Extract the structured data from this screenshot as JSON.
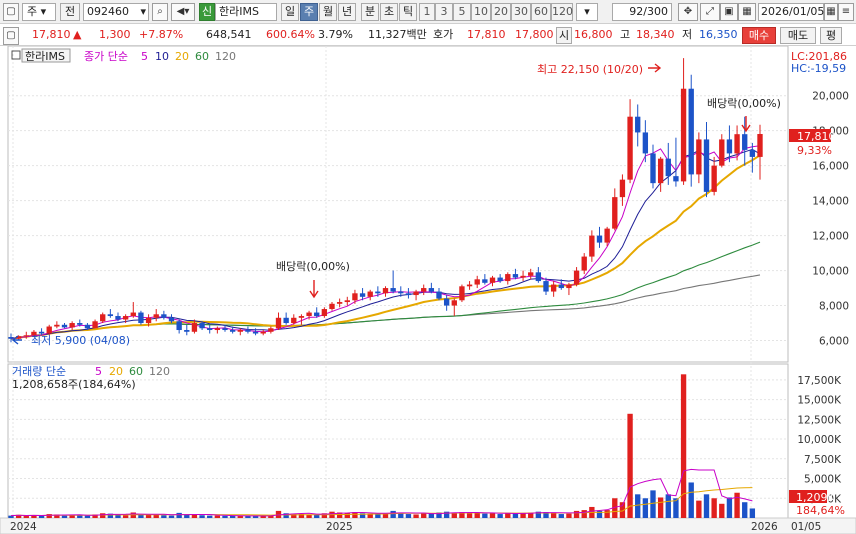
{
  "toolbar": {
    "market": "주",
    "mode": "전",
    "code": "092460",
    "badge": "신",
    "name": "한라IMS",
    "periods": [
      "일",
      "주",
      "월",
      "년",
      "분",
      "초",
      "틱"
    ],
    "selected_period": "주",
    "numbers": [
      "1",
      "3",
      "5",
      "10",
      "20",
      "30",
      "60",
      "120"
    ],
    "count": "92/300",
    "date": "2026/01/05"
  },
  "quote": {
    "price": "17,810",
    "arrow": "▲",
    "change": "1,300",
    "change_pct": "+7.87%",
    "volume": "648,541",
    "vol_ratio": "600.64%",
    "turnover": "3.79%",
    "amount": "11,327백만",
    "hoga_label": "호가",
    "ask": "17,810",
    "bid": "17,800",
    "open_label": "시",
    "open": "16,800",
    "high_label": "고",
    "high": "18,340",
    "low_label": "저",
    "low": "16,350",
    "buy": "매수",
    "sell": "매도",
    "eval": "평"
  },
  "price_legend": {
    "title": "한라IMS",
    "items": [
      "종가 단순",
      "5",
      "10",
      "20",
      "60",
      "120"
    ]
  },
  "volume_legend": {
    "items": [
      "거래량 단순",
      "5",
      "20",
      "60",
      "120"
    ],
    "last": "1,208,658주(184,64%)"
  },
  "annotations": {
    "lc": "LC:201,86",
    "hc": "HC:-19,59",
    "high": "최고 22,150 (10/20)",
    "low": "최저 5,900 (04/08)",
    "div1": "배당락(0,00%)",
    "div2": "배당락(0,00%)",
    "price_tag": "17,810",
    "price_pct": "9,33%",
    "vol_tag": "1,209K",
    "vol_pct": "184,64%"
  },
  "colors": {
    "up": "#e0201e",
    "down": "#1c53c8",
    "ma5": "#c800c8",
    "ma10": "#1e1e96",
    "ma20": "#e6a800",
    "ma60": "#2e8b3e",
    "ma120": "#777777"
  },
  "chart_data": {
    "type": "candlestick",
    "price_axis": {
      "min": 5000,
      "max": 22500,
      "ticks": [
        6000,
        8000,
        10000,
        12000,
        14000,
        16000,
        18000,
        20000
      ]
    },
    "volume_axis": {
      "min": 0,
      "max": 19000,
      "ticks": [
        2500,
        5000,
        7500,
        10000,
        12500,
        15000,
        17500
      ],
      "labels": [
        "2,500K",
        "5,000K",
        "7,500K",
        "10,000K",
        "12,500K",
        "15,000K",
        "17,500K"
      ]
    },
    "price_tick_labels": [
      "6,000",
      "8,000",
      "10,000",
      "12,000",
      "14,000",
      "16,000",
      "18,000",
      "20,000"
    ],
    "x_labels": [
      "2024",
      "2025",
      "2026",
      "01/05"
    ],
    "ohlc": [
      [
        6200,
        6400,
        5900,
        6100
      ],
      [
        6100,
        6300,
        6000,
        6250
      ],
      [
        6250,
        6500,
        6100,
        6300
      ],
      [
        6300,
        6600,
        6200,
        6500
      ],
      [
        6500,
        6700,
        6300,
        6400
      ],
      [
        6400,
        6900,
        6300,
        6800
      ],
      [
        6800,
        7100,
        6700,
        6900
      ],
      [
        6900,
        7000,
        6700,
        6750
      ],
      [
        6750,
        7100,
        6600,
        7000
      ],
      [
        7000,
        7200,
        6800,
        6900
      ],
      [
        6900,
        7000,
        6600,
        6700
      ],
      [
        6700,
        7200,
        6700,
        7100
      ],
      [
        7100,
        7600,
        7000,
        7500
      ],
      [
        7500,
        7800,
        7300,
        7400
      ],
      [
        7400,
        7600,
        7100,
        7200
      ],
      [
        7200,
        7500,
        7000,
        7400
      ],
      [
        7400,
        8200,
        7300,
        7600
      ],
      [
        7600,
        7700,
        6900,
        7000
      ],
      [
        7000,
        7500,
        6800,
        7300
      ],
      [
        7300,
        7800,
        7100,
        7500
      ],
      [
        7500,
        7700,
        7200,
        7300
      ],
      [
        7300,
        7500,
        7000,
        7100
      ],
      [
        7100,
        7200,
        6400,
        6600
      ],
      [
        6600,
        6900,
        6300,
        6500
      ],
      [
        6500,
        7200,
        6400,
        7000
      ],
      [
        7000,
        7100,
        6600,
        6700
      ],
      [
        6700,
        6900,
        6400,
        6600
      ],
      [
        6600,
        6800,
        6400,
        6700
      ],
      [
        6700,
        6900,
        6500,
        6600
      ],
      [
        6600,
        6800,
        6400,
        6500
      ],
      [
        6500,
        6700,
        6300,
        6600
      ],
      [
        6600,
        6800,
        6400,
        6500
      ],
      [
        6500,
        6700,
        6300,
        6400
      ],
      [
        6400,
        6600,
        6300,
        6500
      ],
      [
        6500,
        6800,
        6400,
        6700
      ],
      [
        6700,
        7600,
        6600,
        7300
      ],
      [
        7300,
        7600,
        6900,
        7000
      ],
      [
        7000,
        7500,
        6900,
        7300
      ],
      [
        7300,
        7500,
        6900,
        7400
      ],
      [
        7400,
        7700,
        7200,
        7600
      ],
      [
        7600,
        7900,
        7300,
        7400
      ],
      [
        7400,
        7900,
        7300,
        7800
      ],
      [
        7800,
        8200,
        7700,
        8100
      ],
      [
        8100,
        8400,
        7900,
        8200
      ],
      [
        8200,
        8500,
        8000,
        8300
      ],
      [
        8300,
        8900,
        8100,
        8700
      ],
      [
        8700,
        9000,
        8300,
        8500
      ],
      [
        8500,
        8900,
        8300,
        8800
      ],
      [
        8800,
        9100,
        8500,
        8700
      ],
      [
        8700,
        9100,
        8500,
        9000
      ],
      [
        9000,
        10000,
        8700,
        8800
      ],
      [
        8800,
        9100,
        8500,
        8700
      ],
      [
        8700,
        9000,
        8400,
        8600
      ],
      [
        8600,
        8900,
        8300,
        8800
      ],
      [
        8800,
        9200,
        8600,
        9000
      ],
      [
        9000,
        9300,
        8700,
        8800
      ],
      [
        8800,
        9000,
        8300,
        8400
      ],
      [
        8400,
        8600,
        7700,
        8000
      ],
      [
        8000,
        8400,
        7400,
        8300
      ],
      [
        8300,
        9200,
        8200,
        9100
      ],
      [
        9100,
        9400,
        8900,
        9200
      ],
      [
        9200,
        9700,
        9000,
        9500
      ],
      [
        9500,
        9800,
        9200,
        9300
      ],
      [
        9300,
        9700,
        9100,
        9600
      ],
      [
        9600,
        9800,
        9300,
        9400
      ],
      [
        9400,
        9900,
        9200,
        9800
      ],
      [
        9800,
        10100,
        9500,
        9600
      ],
      [
        9600,
        10000,
        9400,
        9700
      ],
      [
        9700,
        10100,
        9500,
        9900
      ],
      [
        9900,
        10200,
        9300,
        9400
      ],
      [
        9400,
        9600,
        8600,
        8800
      ],
      [
        8800,
        9400,
        8500,
        9200
      ],
      [
        9200,
        9500,
        8900,
        9000
      ],
      [
        9000,
        9300,
        8600,
        9200
      ],
      [
        9200,
        10200,
        9100,
        10000
      ],
      [
        10000,
        11000,
        9800,
        10800
      ],
      [
        10800,
        12300,
        10500,
        12000
      ],
      [
        12000,
        12500,
        11300,
        11600
      ],
      [
        11600,
        12500,
        11400,
        12400
      ],
      [
        12400,
        14700,
        12300,
        14200
      ],
      [
        14200,
        15500,
        13700,
        15200
      ],
      [
        15200,
        19800,
        15000,
        18800
      ],
      [
        18800,
        19500,
        17100,
        17900
      ],
      [
        17900,
        18600,
        16200,
        16700
      ],
      [
        16700,
        17200,
        14700,
        15000
      ],
      [
        15000,
        16500,
        14500,
        16400
      ],
      [
        16400,
        17300,
        14900,
        15400
      ],
      [
        15400,
        17600,
        14800,
        15100
      ],
      [
        15100,
        22150,
        14900,
        20400
      ],
      [
        20400,
        21200,
        14800,
        15500
      ],
      [
        15500,
        17900,
        15000,
        17500
      ],
      [
        17500,
        18500,
        14200,
        14500
      ],
      [
        14500,
        16500,
        14300,
        16000
      ],
      [
        16000,
        17800,
        15900,
        17500
      ],
      [
        17500,
        18300,
        16200,
        16700
      ],
      [
        16700,
        18300,
        16300,
        17800
      ],
      [
        17800,
        18800,
        16000,
        16900
      ],
      [
        16900,
        17300,
        15600,
        16500
      ],
      [
        16500,
        18340,
        15200,
        17810
      ]
    ],
    "volume": [
      300,
      400,
      250,
      350,
      300,
      500,
      450,
      300,
      400,
      350,
      300,
      450,
      600,
      550,
      400,
      350,
      700,
      500,
      400,
      450,
      350,
      300,
      650,
      400,
      500,
      350,
      300,
      300,
      280,
      260,
      250,
      270,
      260,
      240,
      300,
      900,
      600,
      550,
      500,
      450,
      400,
      600,
      800,
      700,
      650,
      750,
      600,
      550,
      500,
      600,
      900,
      700,
      500,
      450,
      600,
      550,
      700,
      800,
      650,
      750,
      600,
      700,
      550,
      600,
      500,
      650,
      550,
      600,
      700,
      800,
      750,
      600,
      500,
      550,
      900,
      1000,
      1400,
      900,
      1000,
      2500,
      2000,
      13200,
      3000,
      2500,
      3500,
      2600,
      3000,
      2500,
      18200,
      4500,
      2200,
      3000,
      2500,
      1800,
      2600,
      3200,
      2000,
      1209
    ]
  }
}
